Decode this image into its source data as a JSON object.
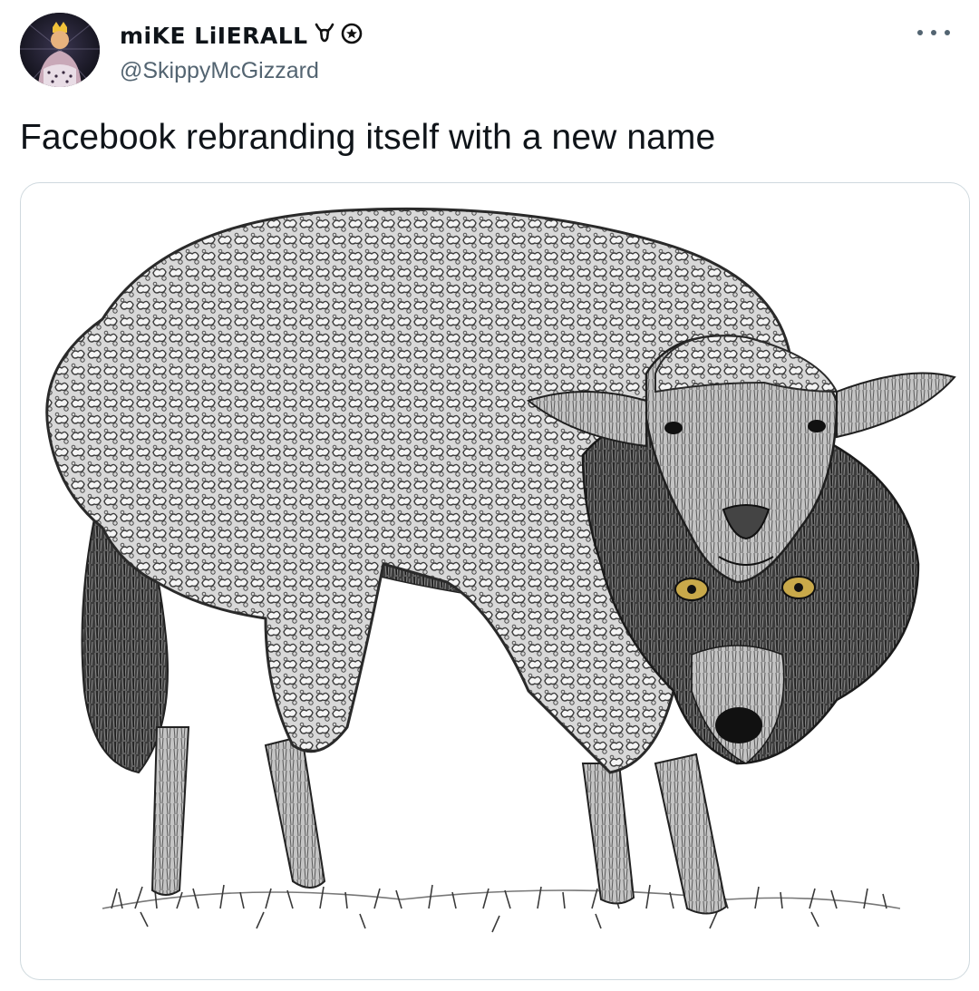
{
  "tweet": {
    "author": {
      "display_name": "miKE LiIERALL",
      "handle": "@SkippyMcGizzard",
      "avatar_icon": "avatar-image",
      "name_emojis": [
        "goat-emoji",
        "circle-star-emoji"
      ]
    },
    "more_icon": "more-dots-icon",
    "text": "Facebook rebranding itself with a new name",
    "media": {
      "kind": "illustration",
      "icon": "wolf-in-sheeps-clothing-illustration"
    }
  },
  "colors": {
    "text_primary": "#0f1419",
    "text_secondary": "#536471",
    "border": "#cfd9de",
    "background": "#ffffff"
  }
}
